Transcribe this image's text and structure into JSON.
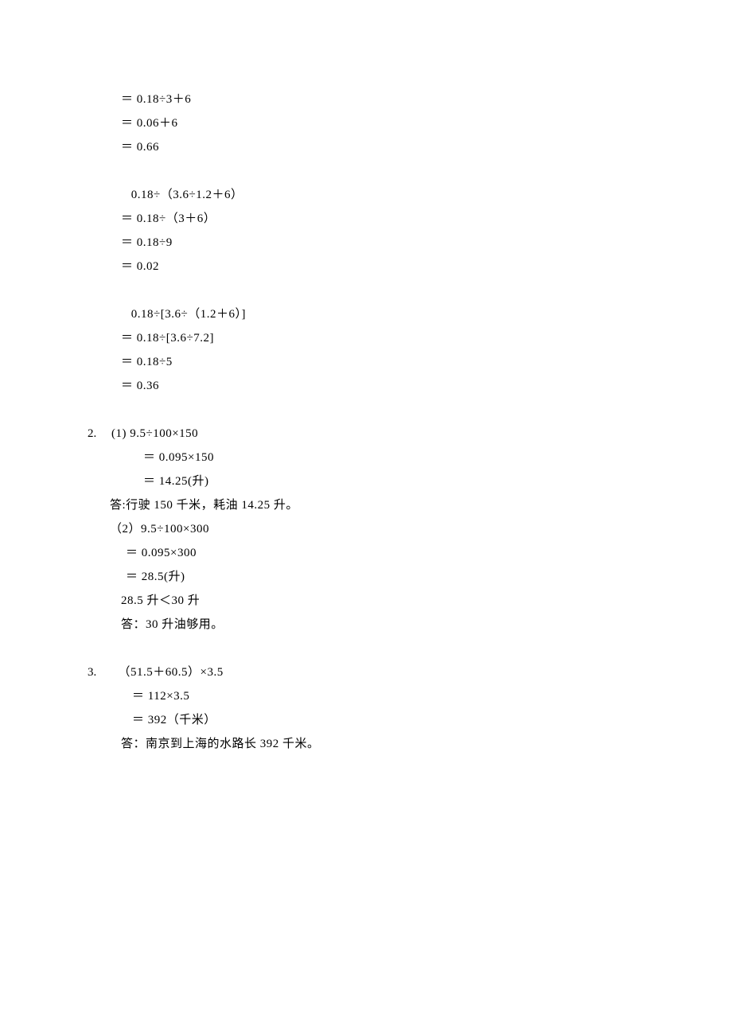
{
  "block1": {
    "l1": "＝ 0.18÷3＋6",
    "l2": "＝ 0.06＋6",
    "l3": "＝ 0.66"
  },
  "block2": {
    "l1": "   0.18÷（3.6÷1.2＋6）",
    "l2": "＝ 0.18÷（3＋6）",
    "l3": "＝ 0.18÷9",
    "l4": "＝ 0.02"
  },
  "block3": {
    "l1": "   0.18÷[3.6÷（1.2＋6）]",
    "l2": "＝ 0.18÷[3.6÷7.2]",
    "l3": "＝ 0.18÷5",
    "l4": "＝ 0.36"
  },
  "p2": {
    "num": "2.",
    "l1": "(1) 9.5÷100×150",
    "l2": "＝ 0.095×150",
    "l3": "＝ 14.25(升)",
    "ans1": "答:行驶 150 千米，耗油 14.25 升。",
    "l4": "（2）9.5÷100×300",
    "l5": "＝ 0.095×300",
    "l6": "＝ 28.5(升)",
    "l7": "28.5 升＜30 升",
    "ans2": "答：30 升油够用。"
  },
  "p3": {
    "num": "3.",
    "l1": "  （51.5＋60.5）×3.5",
    "l2": "＝ 112×3.5",
    "l3": "＝ 392（千米）",
    "ans": "答：南京到上海的水路长 392 千米。"
  }
}
